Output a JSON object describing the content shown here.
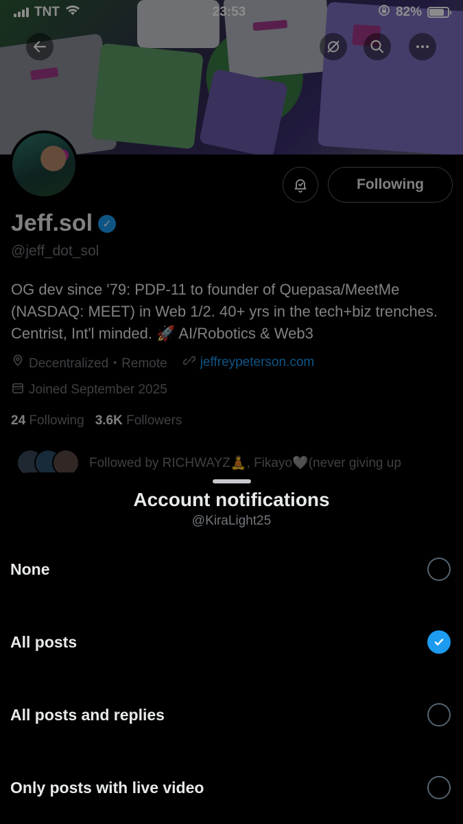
{
  "status_bar": {
    "carrier": "TNT",
    "time": "23:53",
    "battery": "82%",
    "battery_level": 0.82
  },
  "header": {
    "back_icon": "arrow-left-icon",
    "grok_icon": "grok-icon",
    "search_icon": "search-icon",
    "more_icon": "more-icon"
  },
  "profile": {
    "name": "Jeff.sol",
    "handle": "@jeff_dot_sol",
    "bio": "OG dev since '79: PDP-11 to founder of Quepasa/MeetMe (NASDAQ: MEET) in Web 1/2. 40+ yrs in the tech+biz trenches. Centrist, Int'l minded. 🚀 AI/Robotics & Web3",
    "location": "Decentralized・Remote",
    "website": "jeffreypeterson.com",
    "joined": "Joined September 2025",
    "following_count": "24",
    "following_label": "Following",
    "followers_count": "3.6K",
    "followers_label": "Followers",
    "followed_by": "Followed by RICHWAYZ🧘, Fikayo🩶(never giving up",
    "following_button": "Following"
  },
  "sheet": {
    "title": "Account notifications",
    "subtitle": "@KiraLight25",
    "options": [
      {
        "label": "None",
        "selected": false
      },
      {
        "label": "All posts",
        "selected": true
      },
      {
        "label": "All posts and replies",
        "selected": false
      },
      {
        "label": "Only posts with live video",
        "selected": false
      }
    ]
  },
  "colors": {
    "accent": "#1d9bf0",
    "background": "#000000",
    "muted_text": "#71767b"
  }
}
